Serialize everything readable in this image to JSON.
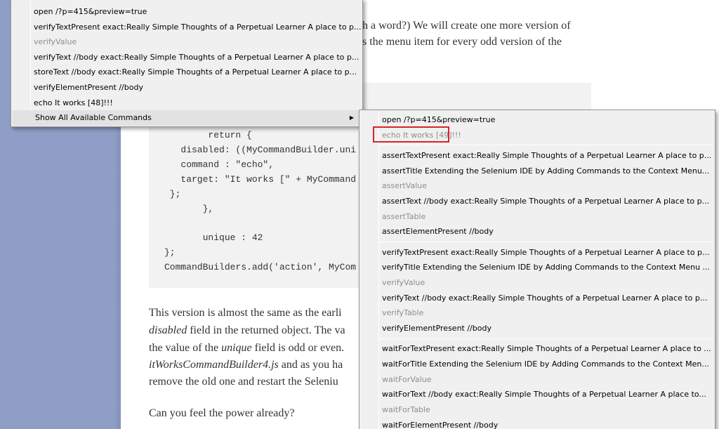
{
  "article": {
    "line1": "h a word?) We will create one more version of",
    "line2": "s the menu item for every odd version of the",
    "code": [
      "        return {",
      "   disabled: ((MyCommandBuilder.uni",
      "   command : \"echo\",",
      "   target: \"It works [\" + MyCommand",
      " };",
      "       },",
      "",
      "       unique : 42",
      "};",
      "CommandBuilders.add('action', MyCom"
    ],
    "para_line1": "This version is almost the same as the earli",
    "para_line2_italic": "disabled",
    "para_line2_rest": " field in the returned object. The va",
    "para_line3_pre": "the value of the ",
    "para_line3_italic": "unique",
    "para_line3_rest": " field is odd or even.",
    "para_line4_italic": "itWorksCommandBuilder4.js",
    "para_line4_rest": " and as you ha",
    "para_line5": "remove the old one and restart the Seleniu",
    "closing": "Can you feel the power already?"
  },
  "menu_main": {
    "items": [
      {
        "label": "open /?p=415&preview=true",
        "disabled": false
      },
      {
        "label": "verifyTextPresent exact:Really Simple Thoughts of a Perpetual Learner  A place to p...",
        "disabled": false
      },
      {
        "label": "verifyValue",
        "disabled": true
      },
      {
        "label": "verifyText //body exact:Really Simple Thoughts of a Perpetual Learner  A place to p...",
        "disabled": false
      },
      {
        "label": "storeText //body exact:Really Simple Thoughts of a Perpetual Learner  A place to p...",
        "disabled": false
      },
      {
        "label": "verifyElementPresent //body",
        "disabled": false
      },
      {
        "label": "echo It works [48]!!!",
        "disabled": false
      },
      {
        "label": "Show All Available Commands",
        "disabled": false
      }
    ]
  },
  "menu_sub": {
    "group1": [
      {
        "label": "open /?p=415&preview=true",
        "disabled": false
      },
      {
        "label": "echo It works [49]!!!",
        "disabled": true
      }
    ],
    "group2": [
      {
        "label": "assertTextPresent exact:Really Simple Thoughts of a Perpetual Learner  A place to p...",
        "disabled": false
      },
      {
        "label": "assertTitle Extending the Selenium IDE by Adding Commands to the Context Menu...",
        "disabled": false
      },
      {
        "label": "assertValue",
        "disabled": true
      },
      {
        "label": "assertText //body exact:Really Simple Thoughts of a Perpetual Learner  A place to p...",
        "disabled": false
      },
      {
        "label": "assertTable",
        "disabled": true
      },
      {
        "label": "assertElementPresent //body",
        "disabled": false
      }
    ],
    "group3": [
      {
        "label": "verifyTextPresent exact:Really Simple Thoughts of a Perpetual Learner  A place to p...",
        "disabled": false
      },
      {
        "label": "verifyTitle Extending the Selenium IDE by Adding Commands to the Context Menu ...",
        "disabled": false
      },
      {
        "label": "verifyValue",
        "disabled": true
      },
      {
        "label": "verifyText //body exact:Really Simple Thoughts of a Perpetual Learner  A place to p...",
        "disabled": false
      },
      {
        "label": "verifyTable",
        "disabled": true
      },
      {
        "label": "verifyElementPresent //body",
        "disabled": false
      }
    ],
    "group4": [
      {
        "label": "waitForTextPresent exact:Really Simple Thoughts of a Perpetual Learner  A place to ...",
        "disabled": false
      },
      {
        "label": "waitForTitle Extending the Selenium IDE by Adding Commands to the Context Men...",
        "disabled": false
      },
      {
        "label": "waitForValue",
        "disabled": true
      },
      {
        "label": "waitForText //body exact:Really Simple Thoughts of a Perpetual Learner  A place to...",
        "disabled": false
      },
      {
        "label": "waitForTable",
        "disabled": true
      },
      {
        "label": "waitForElementPresent //body",
        "disabled": false
      }
    ]
  },
  "icons": {
    "submenu_arrow": "submenu-arrow-icon"
  },
  "colors": {
    "highlight_border": "#d9242b",
    "menu_bg": "#f0f0f0",
    "disabled_text": "#8d8d8d"
  }
}
